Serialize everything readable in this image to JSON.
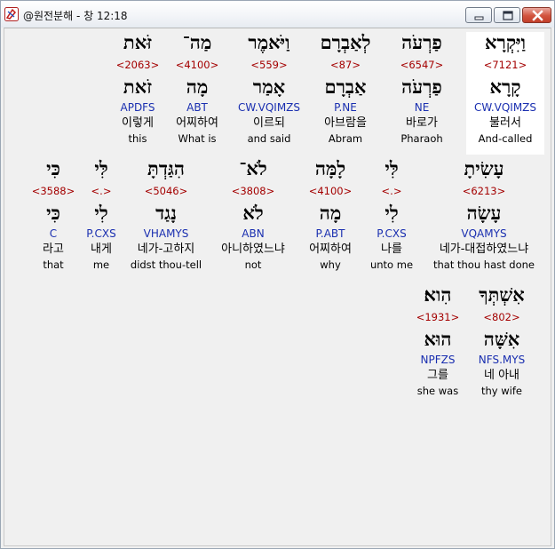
{
  "window": {
    "title": "@원전분해 - 창 12:18"
  },
  "verses": [
    [
      {
        "heb": "וַיִּקְרָא",
        "num": "<7121>",
        "root": "קָרָא",
        "morph": "CW.VQIMZS",
        "kor": "불러서",
        "eng": "And-called",
        "selected": true
      },
      {
        "heb": "פַרְעֹה",
        "num": "<6547>",
        "root": "פַרְעֹה",
        "morph": "NE",
        "kor": "바로가",
        "eng": "Pharaoh"
      },
      {
        "heb": "לְאַבְרָם",
        "num": "<87>",
        "root": "אַבְרָם",
        "morph": "P.NE",
        "kor": "아브람을",
        "eng": "Abram"
      },
      {
        "heb": "וַיֹּאמֶר",
        "num": "<559>",
        "root": "אָמַר",
        "morph": "CW.VQIMZS",
        "kor": "이르되",
        "eng": "and said"
      },
      {
        "heb": "מַה־",
        "num": "<4100>",
        "root": "מָה",
        "morph": "ABT",
        "kor": "어찌하여",
        "eng": "What is"
      },
      {
        "heb": "זֹּאת",
        "num": "<2063>",
        "root": "זֹאת",
        "morph": "APDFS",
        "kor": "이렇게",
        "eng": "this"
      }
    ],
    [
      {
        "heb": "עָשִׂיתָ",
        "num": "<6213>",
        "root": "עָשָׂה",
        "morph": "VQAMYS",
        "kor": "네가-대접하였느냐",
        "eng": "that thou hast done"
      },
      {
        "heb": "לִּי",
        "num": "<.>",
        "root": "לִי",
        "morph": "P.CXS",
        "kor": "나를",
        "eng": "unto me"
      },
      {
        "heb": "לָמָּה",
        "num": "<4100>",
        "root": "מָה",
        "morph": "P.ABT",
        "kor": "어찌하여",
        "eng": "why"
      },
      {
        "heb": "לֹא־",
        "num": "<3808>",
        "root": "לֹא",
        "morph": "ABN",
        "kor": "아니하였느냐",
        "eng": "not"
      },
      {
        "heb": "הִגַּדְתָּ",
        "num": "<5046>",
        "root": "נָגַד",
        "morph": "VHAMYS",
        "kor": "네가-고하지",
        "eng": "didst thou-tell"
      },
      {
        "heb": "לִּי",
        "num": "<.>",
        "root": "לִי",
        "morph": "P.CXS",
        "kor": "내게",
        "eng": "me"
      },
      {
        "heb": "כִּי",
        "num": "<3588>",
        "root": "כִּי",
        "morph": "C",
        "kor": "라고",
        "eng": "that"
      }
    ],
    [
      {
        "heb": "אִשְׁתְּךָ",
        "num": "<802>",
        "root": "אִשָּׁה",
        "morph": "NFS.MYS",
        "kor": "네 아내",
        "eng": "thy wife"
      },
      {
        "heb": "הִוא׃",
        "num": "<1931>",
        "root": "הוּא",
        "morph": "NPFZS",
        "kor": "그를",
        "eng": "she was"
      }
    ]
  ]
}
